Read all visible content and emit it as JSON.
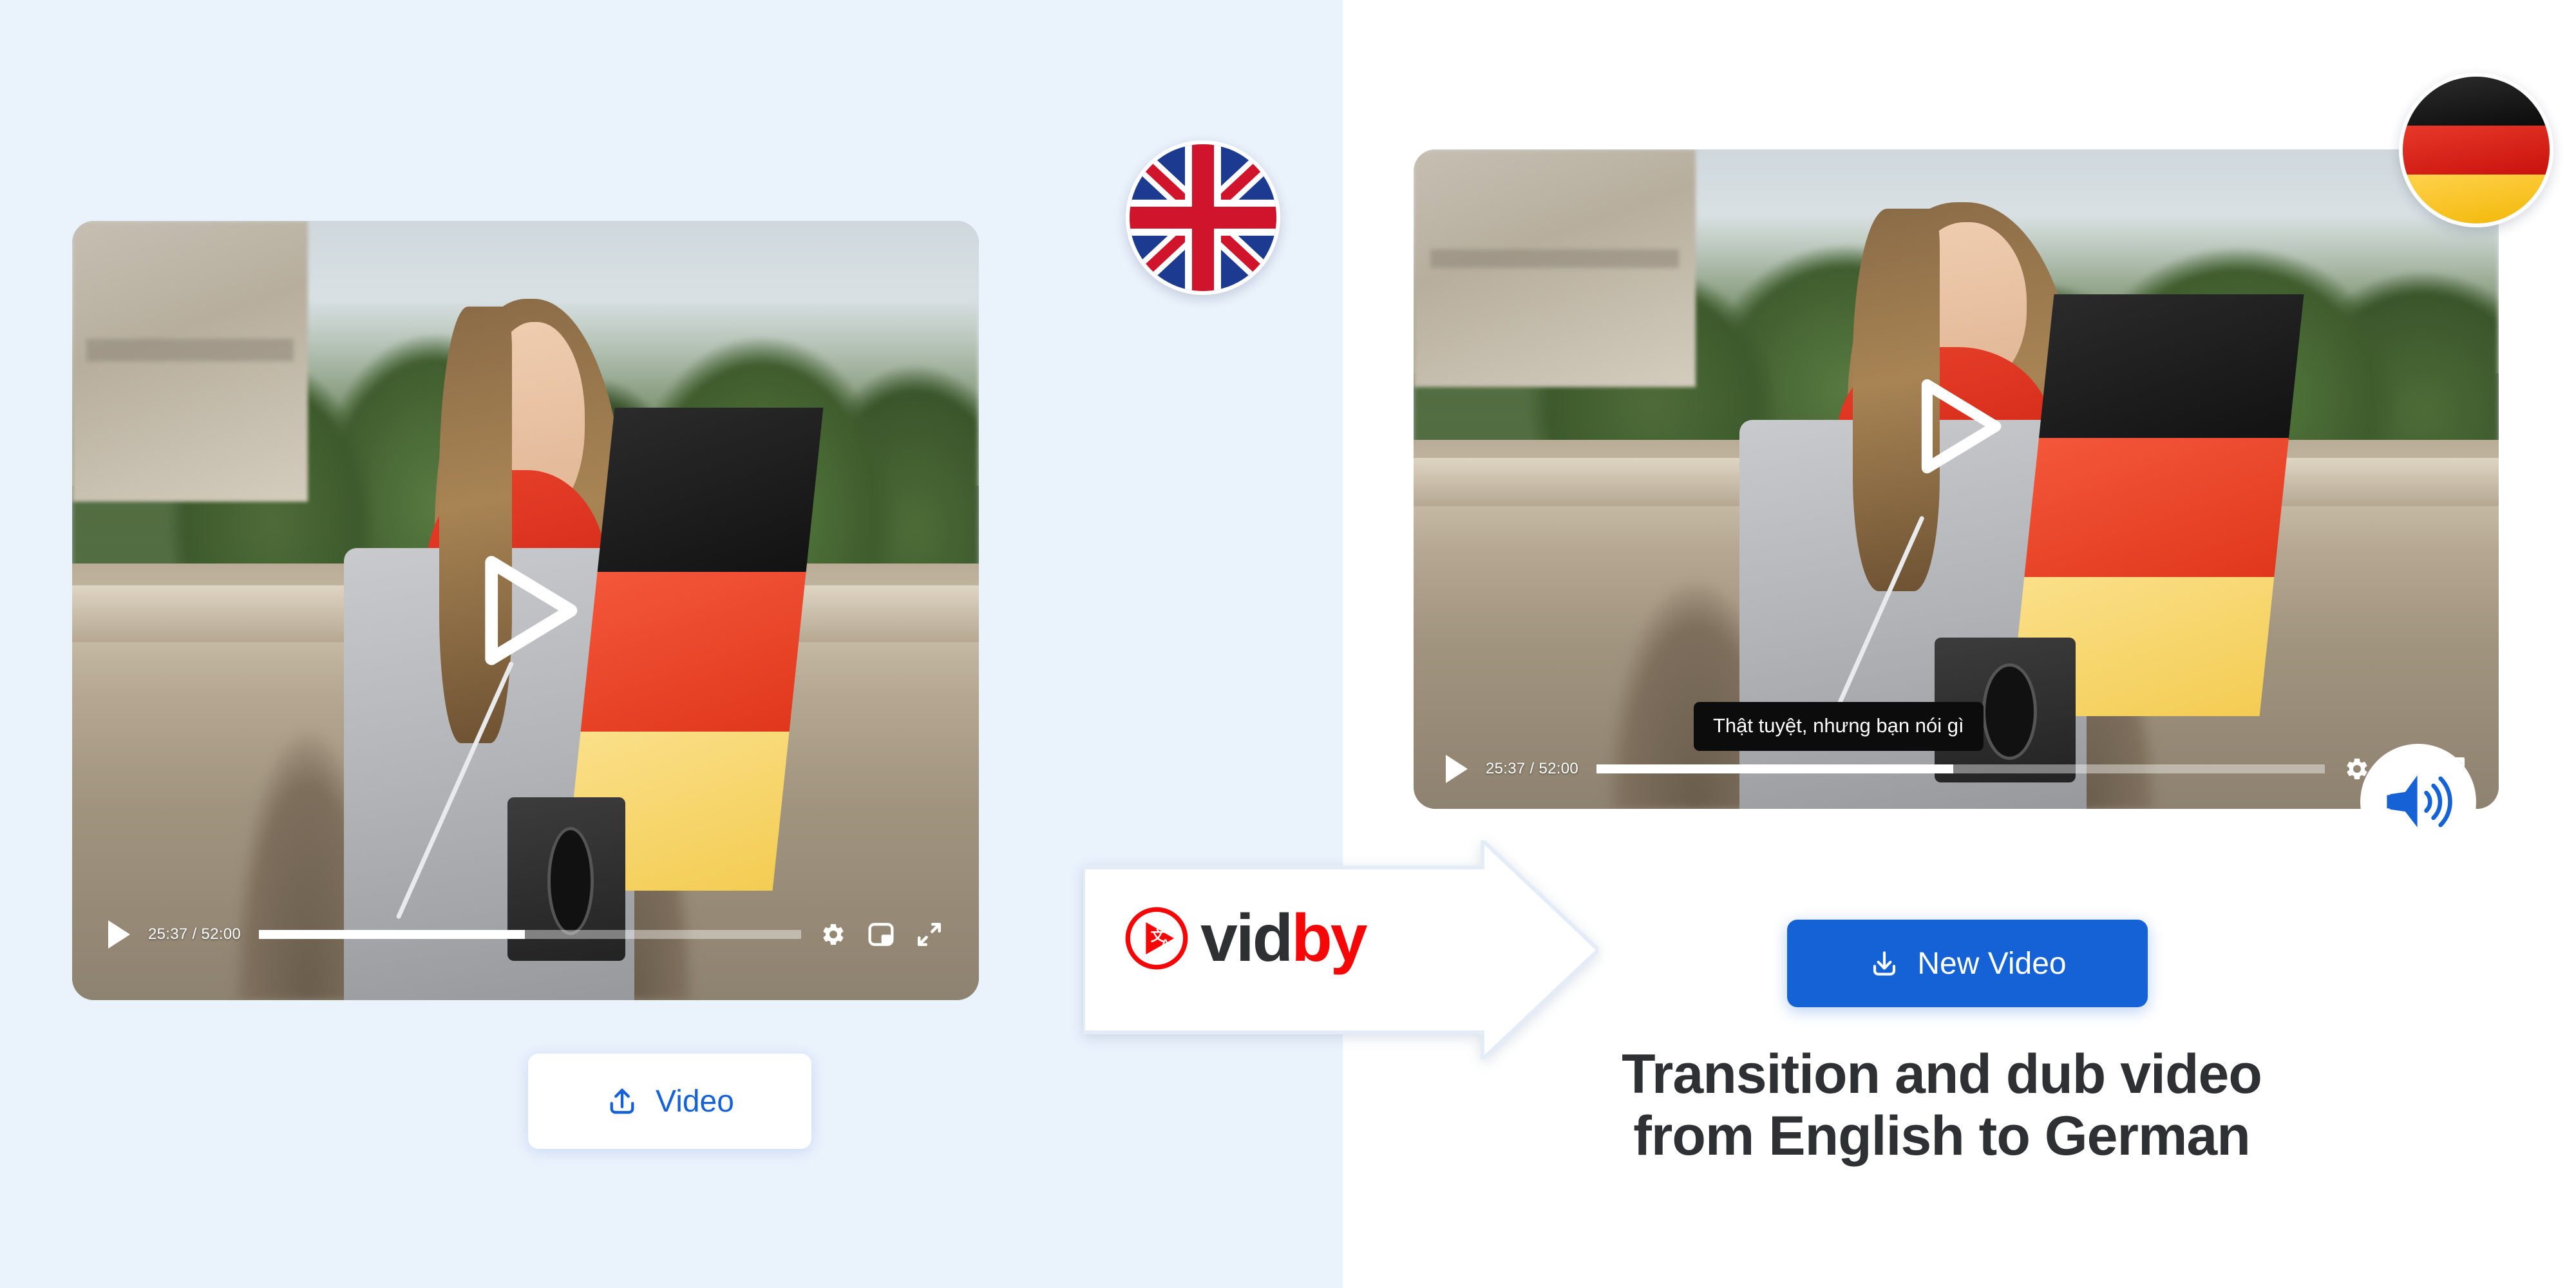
{
  "colors": {
    "left_panel_bg": "#eaf2fc",
    "right_panel_bg": "#ffffff",
    "accent_blue": "#1462d6",
    "logo_red": "#f50707",
    "logo_dark": "#2f3033",
    "subtitle_bg": "#0c0c0c",
    "headline_color": "#2f3033"
  },
  "left_panel": {
    "flag_badge": {
      "icon": "uk-flag-icon",
      "language": "English"
    },
    "player": {
      "play_overlay_icon": "play-triangle-icon",
      "controls": {
        "play_icon": "play-icon",
        "time": "25:37 / 52:00",
        "current_time": "25:37",
        "duration": "52:00",
        "progress_percent": 49,
        "settings_icon": "gear-icon",
        "picture_in_picture_icon": "pip-icon",
        "fullscreen_icon": "fullscreen-icon"
      }
    },
    "upload_button": {
      "label": "Video",
      "icon": "upload-icon"
    }
  },
  "right_panel": {
    "flag_badge": {
      "icon": "de-flag-icon",
      "language": "German"
    },
    "player": {
      "play_overlay_icon": "play-triangle-icon",
      "subtitle_text": "Thật tuyệt, nhưng bạn nói gì",
      "controls": {
        "play_icon": "play-icon",
        "time": "25:37 / 52:00",
        "current_time": "25:37",
        "duration": "52:00",
        "progress_percent": 49,
        "settings_icon": "gear-icon",
        "picture_in_picture_icon": "pip-icon",
        "fullscreen_icon": "fullscreen-icon"
      },
      "audio_badge_icon": "speaker-wave-icon"
    },
    "download_button": {
      "label": "New Video",
      "icon": "download-icon"
    },
    "headline_line1": "Transition and dub video",
    "headline_line2": "from English to German"
  },
  "brand": {
    "name_part1": "vid",
    "name_part2": "by",
    "mark_icon": "vidby-translate-play-icon",
    "arrow_icon": "right-arrow-shape"
  }
}
